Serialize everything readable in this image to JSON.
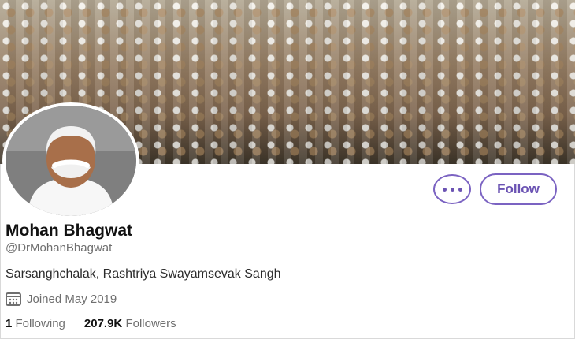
{
  "actions": {
    "more_label": "More options",
    "follow_label": "Follow"
  },
  "profile": {
    "name": "Mohan Bhagwat",
    "handle": "@DrMohanBhagwat",
    "bio": "Sarsanghchalak, Rashtriya Swayamsevak Sangh",
    "joined": "Joined May 2019",
    "following_count": "1",
    "following_label": "Following",
    "followers_count": "207.9K",
    "followers_label": "Followers"
  },
  "icons": {
    "more": "more-icon",
    "calendar": "calendar-icon"
  },
  "colors": {
    "accent": "#6b53b3"
  }
}
